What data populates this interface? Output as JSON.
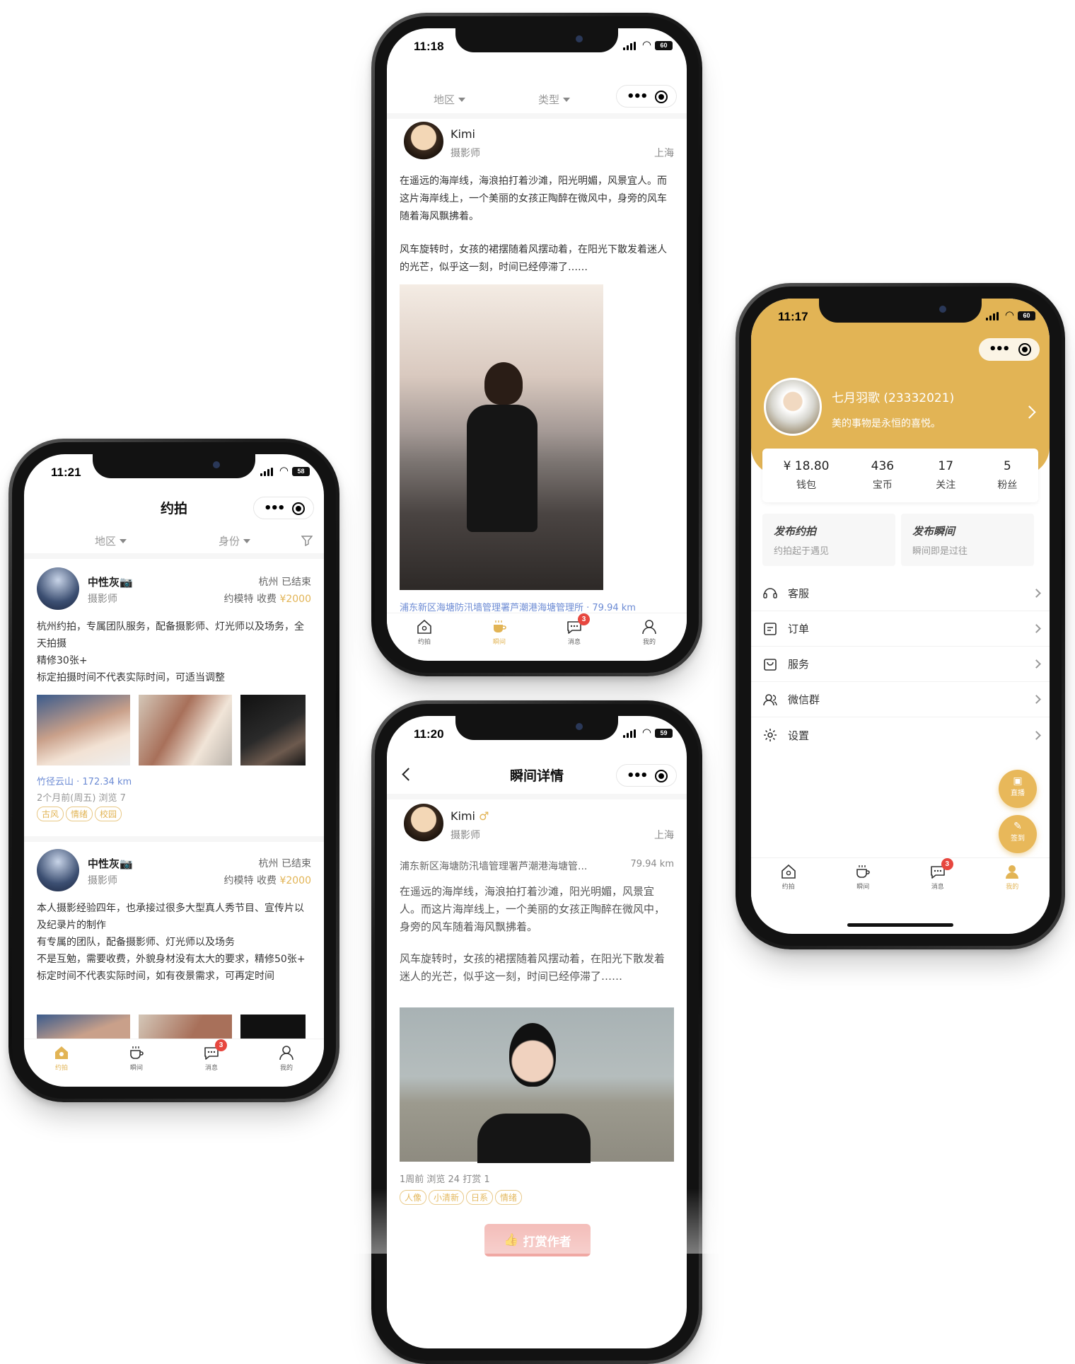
{
  "theme": {
    "accent": "#e2b455",
    "badge": "#e7473f",
    "link": "#6c8bd4"
  },
  "tabbar": {
    "tabs": [
      "约拍",
      "瞬间",
      "消息",
      "我的"
    ],
    "badge": "3"
  },
  "phone_a": {
    "time": "11:21",
    "battery": "58",
    "title": "约拍",
    "filters": [
      "地区",
      "身份"
    ],
    "posts": [
      {
        "name": "中性灰📷",
        "role": "摄影师",
        "city_status": "杭州 已结束",
        "type": "约模特 收费",
        "price": "¥2000",
        "text": [
          "杭州约拍，专属团队服务，配备摄影师、灯光师以及场务，全天拍摄",
          "精修30张+",
          "标定拍摄时间不代表实际时间，可适当调整"
        ],
        "location": "竹径云山 · 172.34 km",
        "meta": "2个月前(周五) 浏览 7",
        "tags": [
          "古风",
          "情绪",
          "校园"
        ]
      },
      {
        "name": "中性灰📷",
        "role": "摄影师",
        "city_status": "杭州 已结束",
        "type": "约模特 收费",
        "price": "¥2000",
        "text": [
          "本人摄影经验四年，也承接过很多大型真人秀节目、宣传片以及纪录片的制作",
          "有专属的团队，配备摄影师、灯光师以及场务",
          "不是互勉，需要收费，外貌身材没有太大的要求，精修50张+",
          "标定时间不代表实际时间，如有夜景需求，可再定时间"
        ]
      }
    ]
  },
  "phone_b": {
    "time": "11:18",
    "battery": "60",
    "filters": [
      "地区",
      "类型"
    ],
    "author": "Kimi",
    "role": "摄影师",
    "city": "上海",
    "paragraphs": [
      "在遥远的海岸线，海浪拍打着沙滩，阳光明媚，风景宜人。而这片海岸线上，一个美丽的女孩正陶醉在微风中，身旁的风车随着海风飘拂着。",
      "风车旋转时，女孩的裙摆随着风摆动着，在阳光下散发着迷人的光芒，似乎这一刻，时间已经停滞了……"
    ],
    "location": "浦东新区海塘防汛墙管理署芦潮港海塘管理所 · 79.94 km"
  },
  "phone_c": {
    "time": "11:20",
    "battery": "59",
    "title": "瞬间详情",
    "author": "Kimi",
    "gender": "♂",
    "role": "摄影师",
    "city": "上海",
    "location": "浦东新区海塘防汛墙管理署芦潮港海塘管...",
    "distance": "79.94 km",
    "paragraphs": [
      "在遥远的海岸线，海浪拍打着沙滩，阳光明媚，风景宜人。而这片海岸线上，一个美丽的女孩正陶醉在微风中，身旁的风车随着海风飘拂着。",
      "风车旋转时，女孩的裙摆随着风摆动着，在阳光下散发着迷人的光芒，似乎这一刻，时间已经停滞了……"
    ],
    "meta": "1周前 浏览 24 打赏 1",
    "tags": [
      "人像",
      "小清新",
      "日系",
      "情绪"
    ],
    "reward_btn": "打赏作者"
  },
  "phone_d": {
    "time": "11:17",
    "battery": "60",
    "username": "七月羽歌 (23332021)",
    "bio": "美的事物是永恒的喜悦。",
    "stats": [
      {
        "v": "¥ 18.80",
        "l": "钱包"
      },
      {
        "v": "436",
        "l": "宝币"
      },
      {
        "v": "17",
        "l": "关注"
      },
      {
        "v": "5",
        "l": "粉丝"
      }
    ],
    "actions": [
      {
        "t": "发布约拍",
        "s": "约拍起于遇见"
      },
      {
        "t": "发布瞬间",
        "s": "瞬间即是过往"
      }
    ],
    "menu": [
      "客服",
      "订单",
      "服务",
      "微信群",
      "设置"
    ],
    "fabs": [
      "直播",
      "签到"
    ]
  }
}
